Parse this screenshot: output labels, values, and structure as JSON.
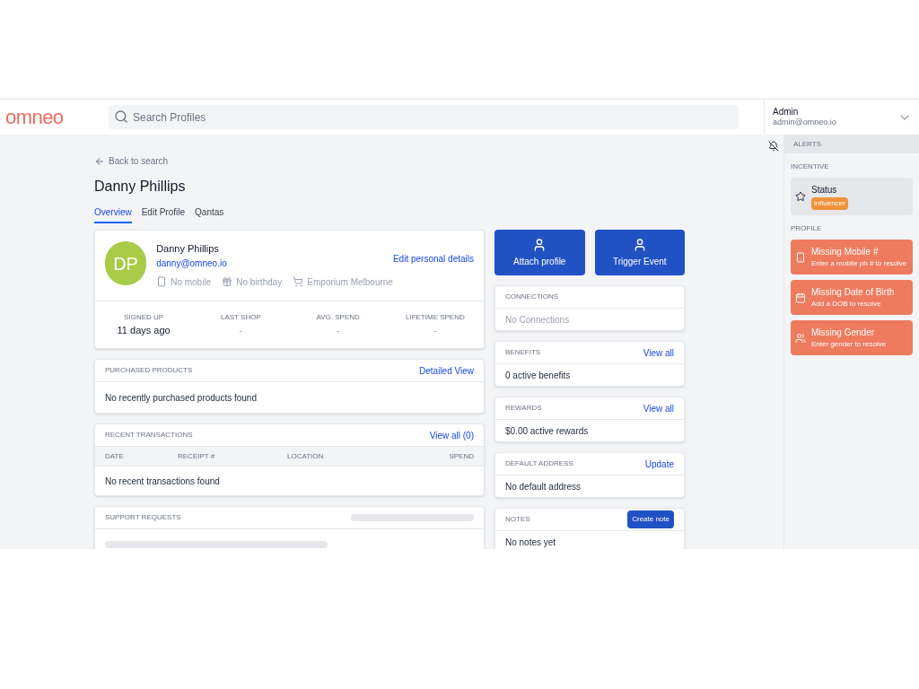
{
  "header": {
    "logo": "omneo",
    "search": {
      "placeholder": "Search Profiles"
    },
    "user": {
      "name": "Admin",
      "email": "admin@omneo.io"
    }
  },
  "back_link": "Back to search",
  "title": "Danny Phillips",
  "tabs": [
    {
      "label": "Overview",
      "selected": true
    },
    {
      "label": "Edit Profile",
      "selected": false
    },
    {
      "label": "Qantas",
      "selected": false
    }
  ],
  "profile": {
    "initials": "DP",
    "name": "Danny Phillips",
    "email": "danny@omneo.io",
    "edit_link": "Edit personal details",
    "meta": [
      {
        "kind": "phone",
        "text": "No mobile"
      },
      {
        "kind": "gift",
        "text": "No birthday"
      },
      {
        "kind": "cart",
        "text": "Emporium Melbourne"
      }
    ],
    "stats": [
      {
        "label": "SIGNED UP",
        "value": "11 days ago"
      },
      {
        "label": "LAST SHOP",
        "value": "-"
      },
      {
        "label": "AVG. SPEND",
        "value": "-"
      },
      {
        "label": "LIFETIME SPEND",
        "value": "-"
      }
    ]
  },
  "purchased_products": {
    "title": "PURCHASED PRODUCTS",
    "link": "Detailed View",
    "empty": "No recently purchased products found"
  },
  "recent_transactions": {
    "title": "RECENT TRANSACTIONS",
    "link": "View all (0)",
    "columns": [
      "DATE",
      "RECEIPT #",
      "LOCATION",
      "SPEND"
    ],
    "empty": "No recent transactions found"
  },
  "support_requests": {
    "title": "SUPPORT REQUESTS"
  },
  "actions": [
    "Attach profile",
    "Trigger Event"
  ],
  "side_cards": [
    {
      "title": "CONNECTIONS",
      "body": "No Connections",
      "muted": true
    },
    {
      "title": "BENEFITS",
      "action": {
        "kind": "link",
        "label": "View all"
      },
      "body": "0 active benefits",
      "muted": false
    },
    {
      "title": "REWARDS",
      "action": {
        "kind": "link",
        "label": "View all"
      },
      "body": "$0.00 active rewards",
      "muted": false
    },
    {
      "title": "DEFAULT ADDRESS",
      "action": {
        "kind": "link",
        "label": "Update"
      },
      "body": "No default address",
      "muted": false
    },
    {
      "title": "NOTES",
      "action": {
        "kind": "button",
        "label": "Create note"
      },
      "body": "No notes yet",
      "muted": false
    }
  ],
  "alerts": {
    "title": "ALERTS",
    "sections": [
      {
        "title": "INCENTIVE",
        "items": [
          {
            "kind": "status",
            "title": "Status",
            "tag": "influencer"
          }
        ]
      },
      {
        "title": "PROFILE",
        "items": [
          {
            "kind": "phone",
            "title": "Missing Mobile #",
            "text": "Enter a mobile ph # to resolve"
          },
          {
            "kind": "calendar",
            "title": "Missing Date of Birth",
            "text": "Add a DOB to resolve"
          },
          {
            "kind": "people",
            "title": "Missing Gender",
            "text": "Enter gender to resolve"
          }
        ]
      }
    ]
  }
}
